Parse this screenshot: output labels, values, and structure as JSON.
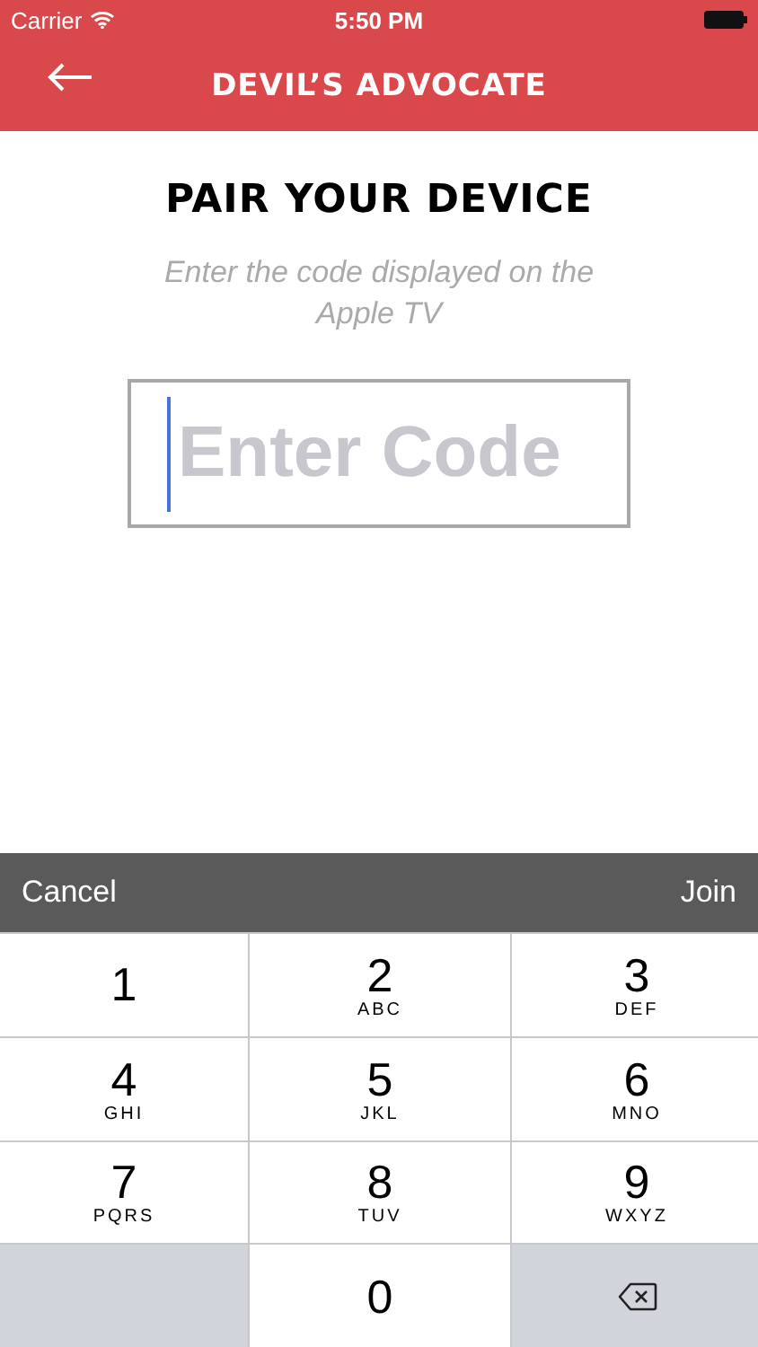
{
  "status_bar": {
    "carrier": "Carrier",
    "time": "5:50 PM"
  },
  "nav": {
    "title": "DEVIL’S ADVOCATE"
  },
  "heading": "PAIR YOUR DEVICE",
  "instruction": "Enter the code displayed on the Apple TV",
  "code_field": {
    "placeholder": "Enter Code"
  },
  "toolbar": {
    "cancel": "Cancel",
    "join": "Join"
  },
  "keys": [
    {
      "kind": "digit",
      "digit": "1"
    },
    {
      "kind": "digit",
      "digit": "2",
      "letters": "ABC"
    },
    {
      "kind": "digit",
      "digit": "3",
      "letters": "DEF"
    },
    {
      "kind": "digit",
      "digit": "4",
      "letters": "GHI"
    },
    {
      "kind": "digit",
      "digit": "5",
      "letters": "JKL"
    },
    {
      "kind": "digit",
      "digit": "6",
      "letters": "MNO"
    },
    {
      "kind": "digit",
      "digit": "7",
      "letters": "PQRS"
    },
    {
      "kind": "digit",
      "digit": "8",
      "letters": "TUV"
    },
    {
      "kind": "digit",
      "digit": "9",
      "letters": "WXYZ"
    },
    {
      "kind": "blank"
    },
    {
      "kind": "digit",
      "digit": "0"
    },
    {
      "kind": "delete"
    }
  ]
}
